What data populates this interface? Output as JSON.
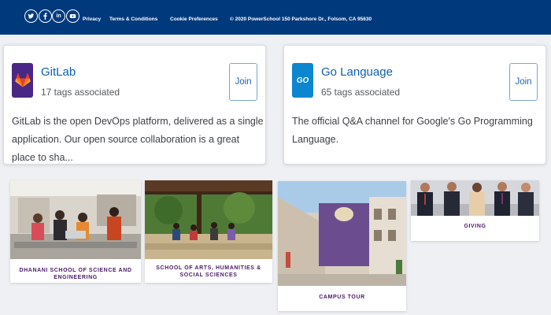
{
  "footer": {
    "social": [
      {
        "icon": "twitter-icon",
        "glyph": "t"
      },
      {
        "icon": "facebook-icon",
        "glyph": "f"
      },
      {
        "icon": "linkedin-icon",
        "glyph": "in"
      },
      {
        "icon": "youtube-icon",
        "glyph": "▶"
      }
    ],
    "links": [
      "Privacy",
      "Terms & Conditions",
      "Cookie Preferences"
    ],
    "copyright": "© 2020 PowerSchool 150 Parkshore Dr., Folsom, CA 95630",
    "bg_color": "#003a7d"
  },
  "communities": [
    {
      "name": "GitLab",
      "tags": "17 tags associated",
      "description_line1": "GitLab is the open DevOps platform, delivered as a single",
      "description_line2": "application. Our open source collaboration is a great place to sha...",
      "join_label": "Join",
      "logo_icon": "gitlab-icon",
      "logo_color": "#4b2785"
    },
    {
      "name": "Go Language",
      "tags": "65 tags associated",
      "description_line1": "The official Q&A channel for Google's Go Programming Language.",
      "join_label": "Join",
      "logo_icon": "go-gopher-icon",
      "logo_color": "#0b86cf"
    }
  ],
  "schools": [
    {
      "label": "Dhanani School of Science and Engineering"
    },
    {
      "label": "School of Arts, Humanities & Social Sciences"
    },
    {
      "label": "Campus Tour"
    },
    {
      "label": "Giving"
    }
  ]
}
